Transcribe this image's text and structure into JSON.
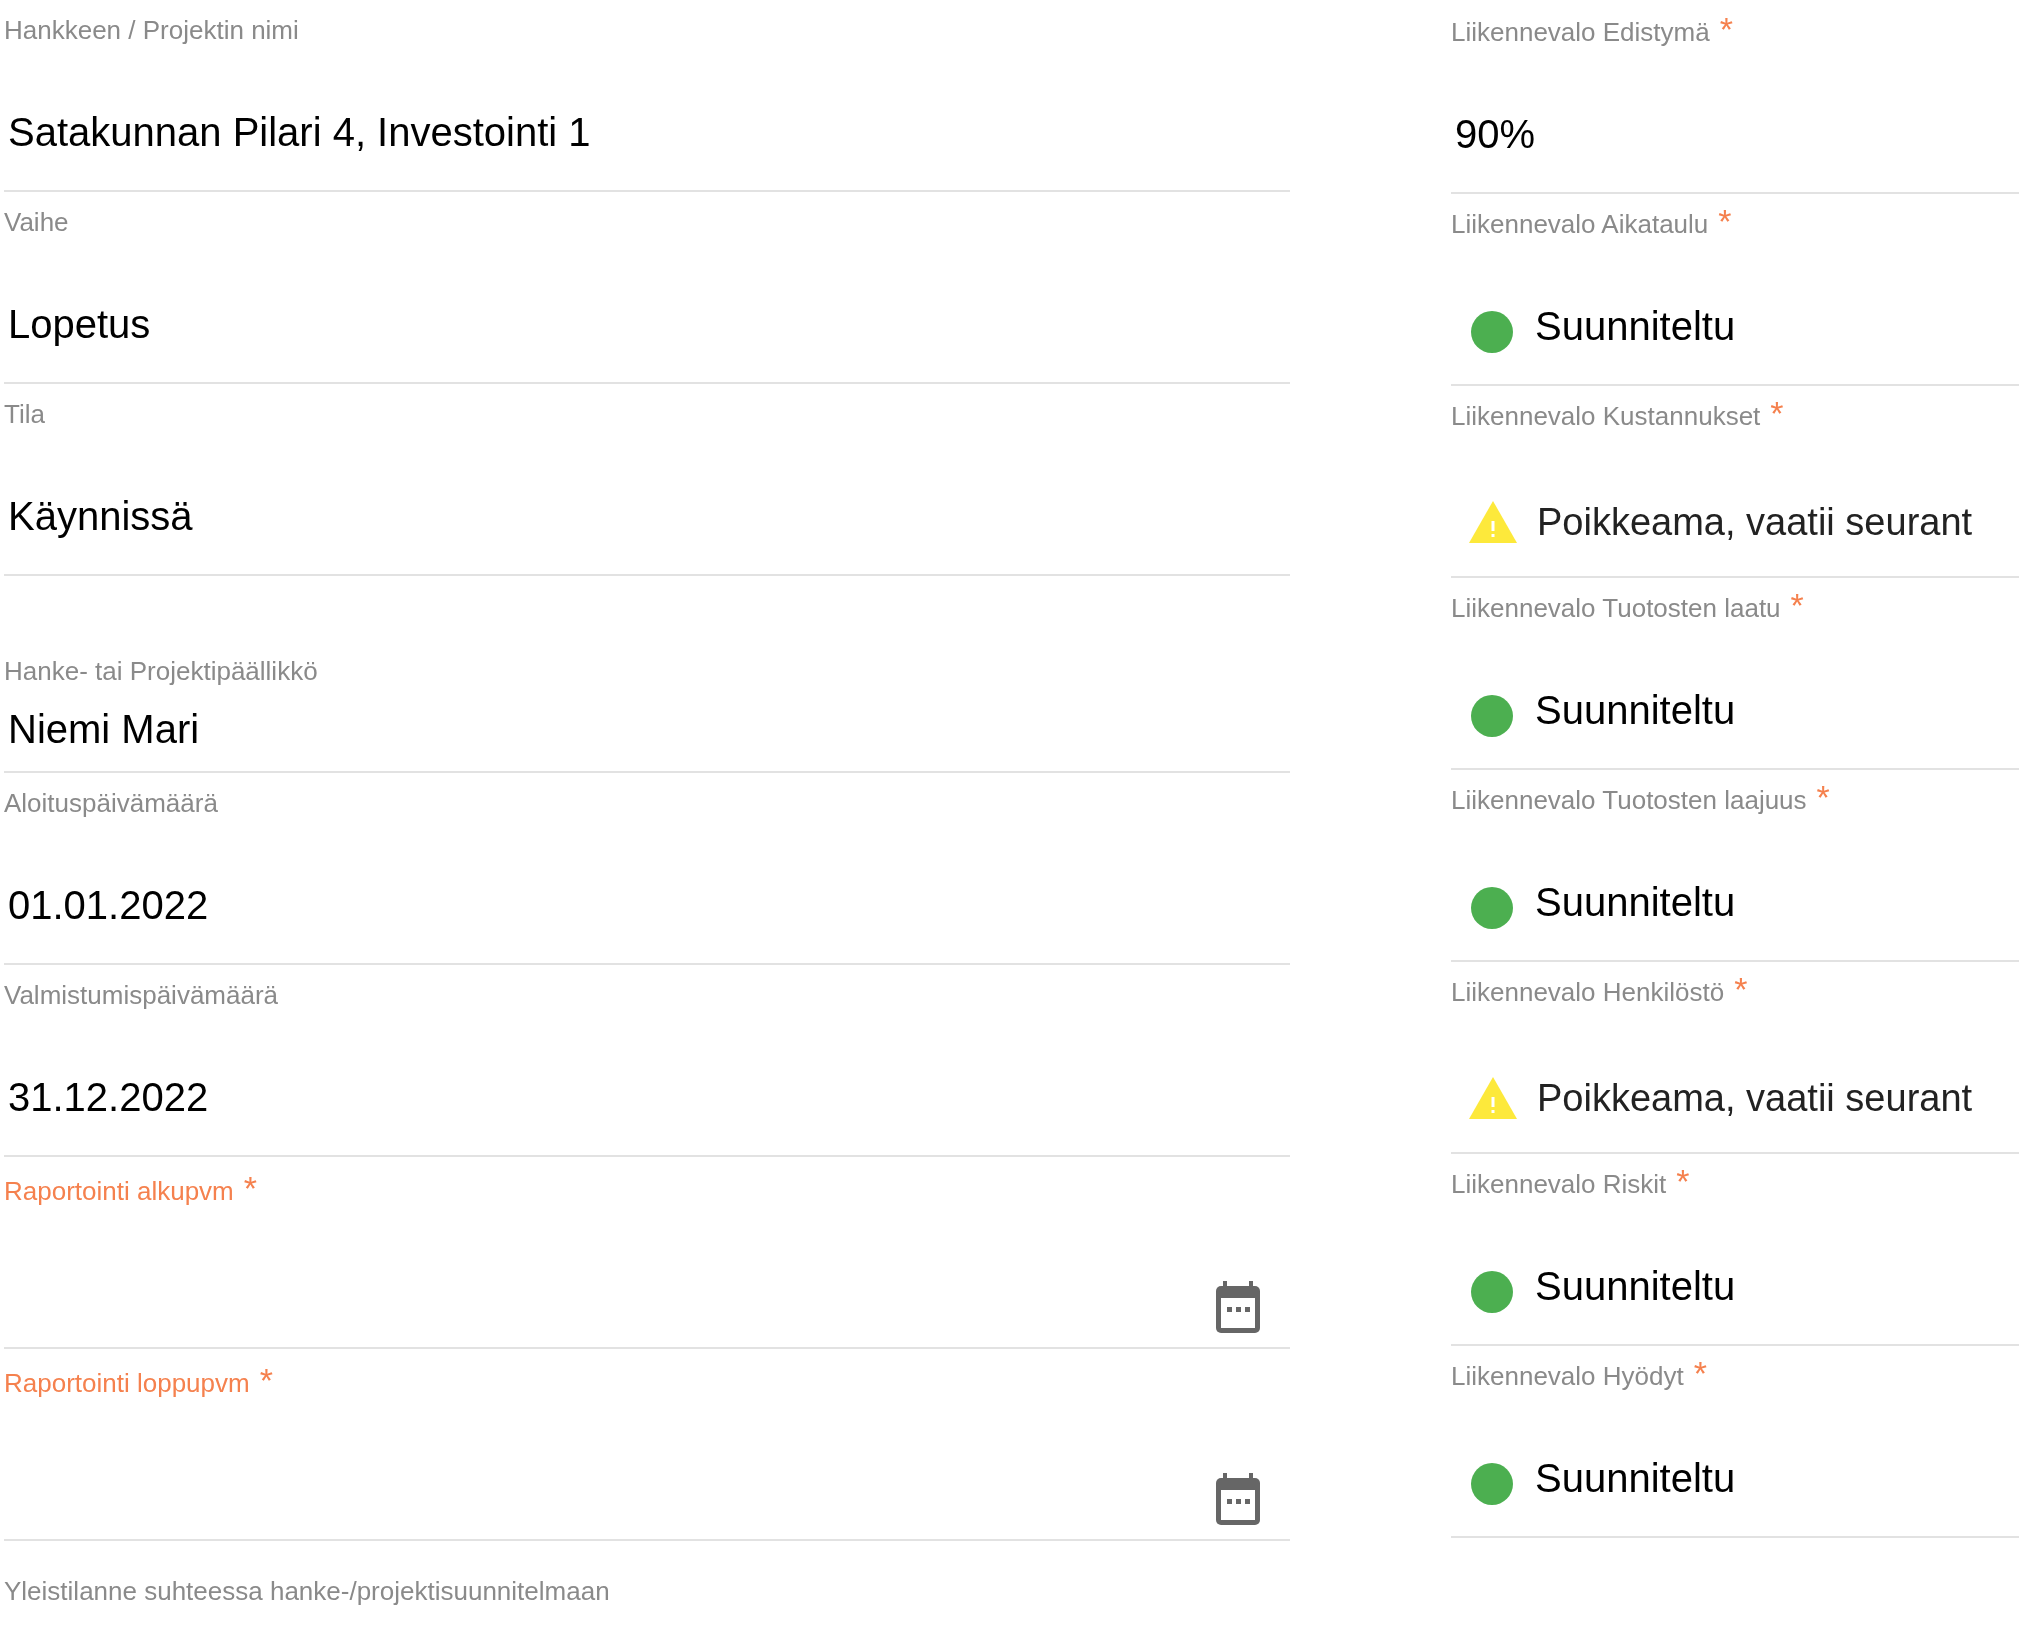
{
  "required_mark": "*",
  "left_fields": [
    {
      "kind": "text",
      "label": "Hankkeen / Projektin nimi",
      "value": "Satakunnan Pilari 4, Investointi 1",
      "required": false
    },
    {
      "kind": "text",
      "label": "Vaihe",
      "value": "Lopetus",
      "required": false
    },
    {
      "kind": "text",
      "label": "Tila",
      "value": "Käynnissä",
      "required": false
    },
    {
      "kind": "compact",
      "label": "Hanke- tai Projektipäällikkö",
      "value": "Niemi Mari",
      "required": false
    },
    {
      "kind": "text",
      "label": "Aloituspäivämäärä",
      "value": "01.01.2022",
      "required": false
    },
    {
      "kind": "text",
      "label": "Valmistumispäivämäärä",
      "value": "31.12.2022",
      "required": false
    },
    {
      "kind": "date",
      "label": "Raportointi alkupvm",
      "required": true
    },
    {
      "kind": "date",
      "label": "Raportointi loppupvm",
      "required": true
    },
    {
      "kind": "heading",
      "label": "Yleistilanne suhteessa hanke-/projektisuunnitelmaan",
      "required": false
    }
  ],
  "right_fields": [
    {
      "kind": "text",
      "label": "Liikennevalo Edistymä",
      "value": "90%",
      "required": true
    },
    {
      "kind": "ok",
      "label": "Liikennevalo Aikataulu",
      "value": "Suunniteltu",
      "required": true
    },
    {
      "kind": "warning",
      "label": "Liikennevalo Kustannukset",
      "value": "Poikkeama, vaatii seurant",
      "required": true
    },
    {
      "kind": "ok",
      "label": "Liikennevalo Tuotosten laatu",
      "value": "Suunniteltu",
      "required": true
    },
    {
      "kind": "ok",
      "label": "Liikennevalo Tuotosten laajuus",
      "value": "Suunniteltu",
      "required": true
    },
    {
      "kind": "warning",
      "label": "Liikennevalo Henkilöstö",
      "value": "Poikkeama, vaatii seurant",
      "required": true
    },
    {
      "kind": "ok",
      "label": "Liikennevalo Riskit",
      "value": "Suunniteltu",
      "required": true
    },
    {
      "kind": "ok",
      "label": "Liikennevalo Hyödyt",
      "value": "Suunniteltu",
      "required": true
    }
  ]
}
